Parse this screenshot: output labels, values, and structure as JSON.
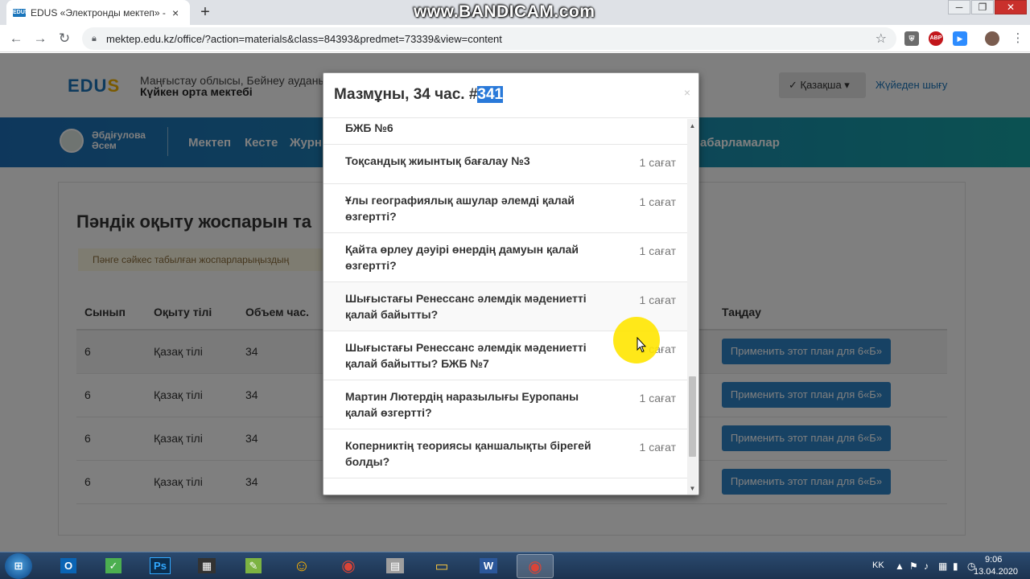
{
  "browser": {
    "tab_title": "EDUS «Электронды мектеп» - К",
    "tab_favicon_text": "EDUS",
    "tab_close": "×",
    "new_tab": "+",
    "watermark": "www.BANDICAM.com",
    "url": "mektep.edu.kz/office/?action=materials&class=84393&predmet=73339&view=content",
    "back_icon": "←",
    "forward_icon": "→",
    "reload_icon": "↻",
    "star_icon": "☆",
    "win_minimize": "─",
    "win_restore": "❐",
    "win_close": "✕",
    "extensions": [
      {
        "name": "shield",
        "color": "#6b6b6b",
        "glyph": "⛨"
      },
      {
        "name": "abp",
        "color": "#c2161b",
        "glyph": "ABP"
      },
      {
        "name": "zoom",
        "color": "#2d8cff",
        "glyph": "▶"
      }
    ]
  },
  "site": {
    "logo_main": "EDU",
    "logo_s": "S",
    "region": "Маңғыстау облысы, Бейнеу ауданы",
    "school": "Күйкен орта мектебі",
    "language": "✓ Қазақша ▾",
    "logout": "Жүйеден шығу",
    "user_name_line1": "Әбдіғулова",
    "user_name_line2": "Әсем",
    "nav": [
      "Мектеп",
      "Кесте",
      "Журн",
      "абарламалар"
    ]
  },
  "plan_page": {
    "title": "Пәндік оқыту жоспарын та",
    "notice": "Пәнге сәйкес табылған жоспарларыңыздың",
    "columns": [
      "Сынып",
      "Оқыту тілі",
      "Объем час.",
      "Таңдау"
    ],
    "rows": [
      {
        "class": "6",
        "lang": "Қазақ тілі",
        "volume": "34",
        "button": "Применить этот план для 6«Б»"
      },
      {
        "class": "6",
        "lang": "Қазақ тілі",
        "volume": "34",
        "button": "Применить этот план для 6«Б»"
      },
      {
        "class": "6",
        "lang": "Қазақ тілі",
        "volume": "34",
        "button": "Применить этот план для 6«Б»"
      },
      {
        "class": "6",
        "lang": "Қазақ тілі",
        "volume": "34",
        "button": "Применить этот план для 6«Б»"
      }
    ]
  },
  "modal": {
    "title_prefix": "Мазмұны, 34 час. #",
    "title_selected": "341",
    "close": "×",
    "lessons": [
      {
        "title": "БЖБ №6",
        "hours": ""
      },
      {
        "title": "Тоқсандық жиынтық бағалау №3",
        "hours": "1 сағат"
      },
      {
        "title": "Ұлы географиялық ашулар әлемді қалай өзгертті?",
        "hours": "1 сағат"
      },
      {
        "title": "Қайта өрлеу дәуірі өнердің дамуын қалай өзгертті?",
        "hours": "1 сағат"
      },
      {
        "title": "Шығыстағы Ренессанс әлемдік мәдениетті қалай байытты?",
        "hours": "1 сағат"
      },
      {
        "title": "Шығыстағы Ренессанс әлемдік мәдениетті қалай байытты? БЖБ №7",
        "hours": "1 сағат"
      },
      {
        "title": "Мартин Лютердің наразылығы Еуропаны қалай өзгертті?",
        "hours": "1 сағат"
      },
      {
        "title": "Коперниктің теориясы қаншалықты бірегей болды?",
        "hours": "1 сағат"
      }
    ],
    "scroll_up": "▲",
    "scroll_down": "▼"
  },
  "taskbar": {
    "apps": [
      {
        "name": "outlook",
        "label": "O",
        "color": "#0a64b4"
      },
      {
        "name": "maps",
        "label": "✓",
        "color": "#4caf50"
      },
      {
        "name": "photoshop",
        "label": "Ps",
        "color": "#0b2e4f"
      },
      {
        "name": "film",
        "label": "▦",
        "color": "#333"
      },
      {
        "name": "leaf",
        "label": "✎",
        "color": "#7cb342"
      },
      {
        "name": "emoji-pro",
        "label": "☺",
        "color": "#ffb300"
      },
      {
        "name": "chrome",
        "label": "◉",
        "color": "#db4437"
      },
      {
        "name": "calculator",
        "label": "▤",
        "color": "#9e9e9e"
      },
      {
        "name": "explorer",
        "label": "▭",
        "color": "#f0c040"
      },
      {
        "name": "word",
        "label": "W",
        "color": "#2b579a"
      },
      {
        "name": "chrome-active",
        "label": "◉",
        "color": "#db4437"
      }
    ],
    "tray_lang": "KK",
    "time": "9:06",
    "date": "13.04.2020"
  }
}
